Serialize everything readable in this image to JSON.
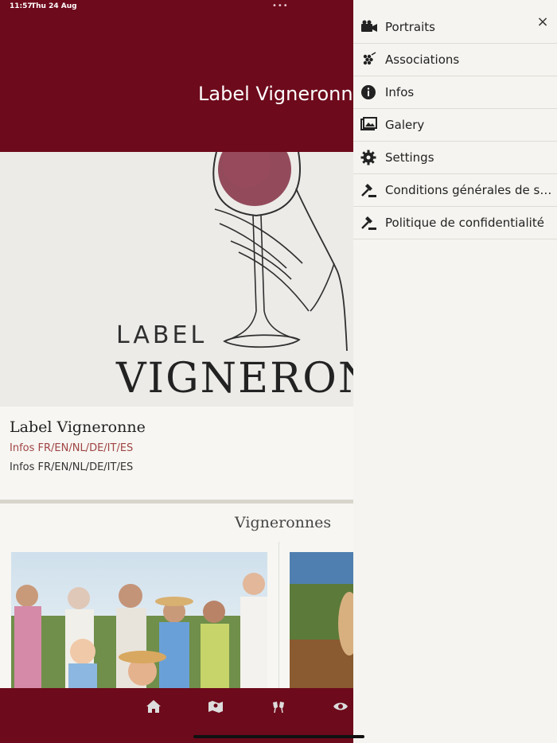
{
  "status_bar": {
    "time": "11:57",
    "date": "Thu 24 Aug",
    "dots": "•••"
  },
  "header": {
    "title": "Label Vigneronne"
  },
  "hero": {
    "label_text": "LABEL",
    "brand_text": "VIGNERON"
  },
  "info_card": {
    "title": "Label Vigneronne",
    "link": "Infos FR/EN/NL/DE/IT/ES",
    "text": "Infos FR/EN/NL/DE/IT/ES"
  },
  "section": {
    "title": "Vigneronnes"
  },
  "drawer": {
    "close_symbol": "×",
    "items": [
      {
        "label": "Portraits",
        "icon": "camera-icon"
      },
      {
        "label": "Associations",
        "icon": "grapes-icon"
      },
      {
        "label": "Infos",
        "icon": "info-icon"
      },
      {
        "label": "Galery",
        "icon": "gallery-icon"
      },
      {
        "label": "Settings",
        "icon": "gear-icon"
      },
      {
        "label": "Conditions générales de se...",
        "icon": "gavel-icon"
      },
      {
        "label": "Politique de confidentialité",
        "icon": "gavel-icon"
      }
    ]
  },
  "bottom_nav": {
    "items": [
      {
        "icon": "home-icon"
      },
      {
        "icon": "map-icon"
      },
      {
        "icon": "toast-icon"
      },
      {
        "icon": "eye-icon"
      }
    ]
  },
  "colors": {
    "brand": "#6d0a1b",
    "link": "#a04444",
    "background": "#f4f3ef"
  }
}
